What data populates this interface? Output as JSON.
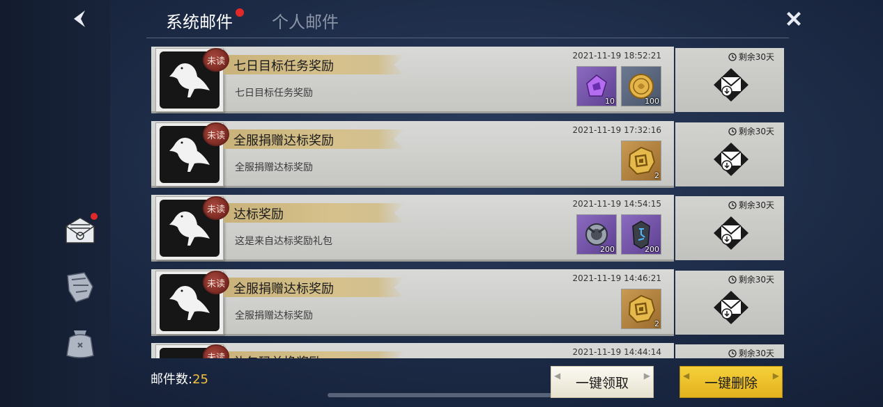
{
  "header": {
    "tabs": [
      {
        "label": "系统邮件",
        "active": true,
        "has_notification": true
      },
      {
        "label": "个人邮件",
        "active": false,
        "has_notification": false
      }
    ]
  },
  "sidebar": {
    "items": [
      {
        "icon": "mail-icon",
        "has_notification": true
      },
      {
        "icon": "scroll-icon",
        "has_notification": false
      },
      {
        "icon": "bag-icon",
        "has_notification": false
      }
    ]
  },
  "mails": [
    {
      "seal": "未读",
      "title": "七日目标任务奖励",
      "subtitle": "七日目标任务奖励",
      "date": "2021-11-19 18:52:21",
      "expire": "剩余30天",
      "items": [
        {
          "icon": "purple-crystal-icon",
          "bg": "purple",
          "qty": "10"
        },
        {
          "icon": "gold-coin-icon",
          "bg": "blue",
          "qty": "100"
        }
      ]
    },
    {
      "seal": "未读",
      "title": "全服捐赠达标奖励",
      "subtitle": "全服捐赠达标奖励",
      "date": "2021-11-19 17:32:16",
      "expire": "剩余30天",
      "items": [
        {
          "icon": "gold-token-icon",
          "bg": "gold",
          "qty": "2"
        }
      ]
    },
    {
      "seal": "未读",
      "title": "达标奖励",
      "subtitle": "这是来自达标奖励礼包",
      "date": "2021-11-19 14:54:15",
      "expire": "剩余30天",
      "items": [
        {
          "icon": "silver-ring-icon",
          "bg": "purple",
          "qty": "200"
        },
        {
          "icon": "dark-rune-icon",
          "bg": "purple",
          "qty": "200"
        }
      ]
    },
    {
      "seal": "未读",
      "title": "全服捐赠达标奖励",
      "subtitle": "全服捐赠达标奖励",
      "date": "2021-11-19 14:46:21",
      "expire": "剩余30天",
      "items": [
        {
          "icon": "gold-token-icon",
          "bg": "gold",
          "qty": "2"
        }
      ]
    },
    {
      "seal": "未读",
      "title": "礼包码兑换奖励",
      "subtitle": "",
      "date": "2021-11-19 14:44:14",
      "expire": "剩余30天",
      "items": []
    }
  ],
  "footer": {
    "count_label": "邮件数:",
    "count_value": "25",
    "claim_all_label": "一键领取",
    "delete_all_label": "一键删除"
  },
  "colors": {
    "accent_red": "#e02a2a",
    "count_yellow": "#f2c23b",
    "delete_button": "#e3b21e"
  }
}
